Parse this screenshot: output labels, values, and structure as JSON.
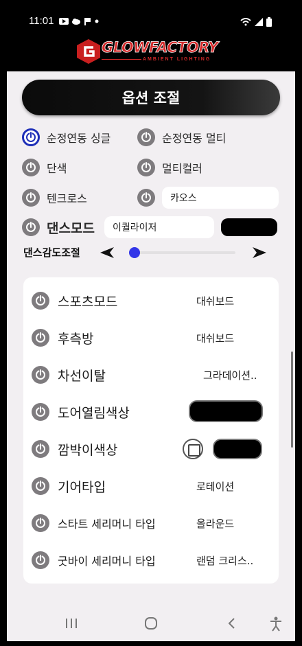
{
  "status": {
    "time": "11:01"
  },
  "brand": {
    "logo_text": "GLOWFACTORY",
    "logo_sub": "AMBIENT LIGHTING"
  },
  "title": "옵션 조절",
  "modes": [
    {
      "label": "순정연동 싱글",
      "active": true
    },
    {
      "label": "순정연동 멀티",
      "active": false
    },
    {
      "label": "단색",
      "active": false
    },
    {
      "label": "멀티컬러",
      "active": false
    },
    {
      "label": "텐크로스",
      "active": false
    },
    {
      "label": "",
      "active": false
    },
    {
      "label": "댄스모드",
      "active": false
    }
  ],
  "chips": {
    "chaos": "카오스",
    "equalizer": "이퀄라이저"
  },
  "sensitivity": {
    "label": "댄스감도조절",
    "value_fraction": 0.0
  },
  "card_rows": [
    {
      "label": "스포츠모드",
      "value": "대쉬보드"
    },
    {
      "label": "후측방",
      "value": "대쉬보드"
    },
    {
      "label": "차선이탈",
      "value": "그라데이션.."
    },
    {
      "label": "도어열림색상",
      "value": ""
    },
    {
      "label": "깜박이색상",
      "value": ""
    },
    {
      "label": "기어타입",
      "value": "로테이션"
    },
    {
      "label": "스타트 세리머니 타입",
      "value": "올라운드"
    },
    {
      "label": "굿바이 세리머니 타입",
      "value": "랜덤 크리스.."
    }
  ],
  "colors": {
    "accent_blue": "#1f2fb8",
    "slider_thumb": "#3336e8",
    "brand_red": "#d42a2a"
  },
  "icons": {
    "power": "power-icon",
    "back": "back-icon",
    "home": "home-icon",
    "recents": "recents-icon",
    "accessibility": "accessibility-icon"
  }
}
